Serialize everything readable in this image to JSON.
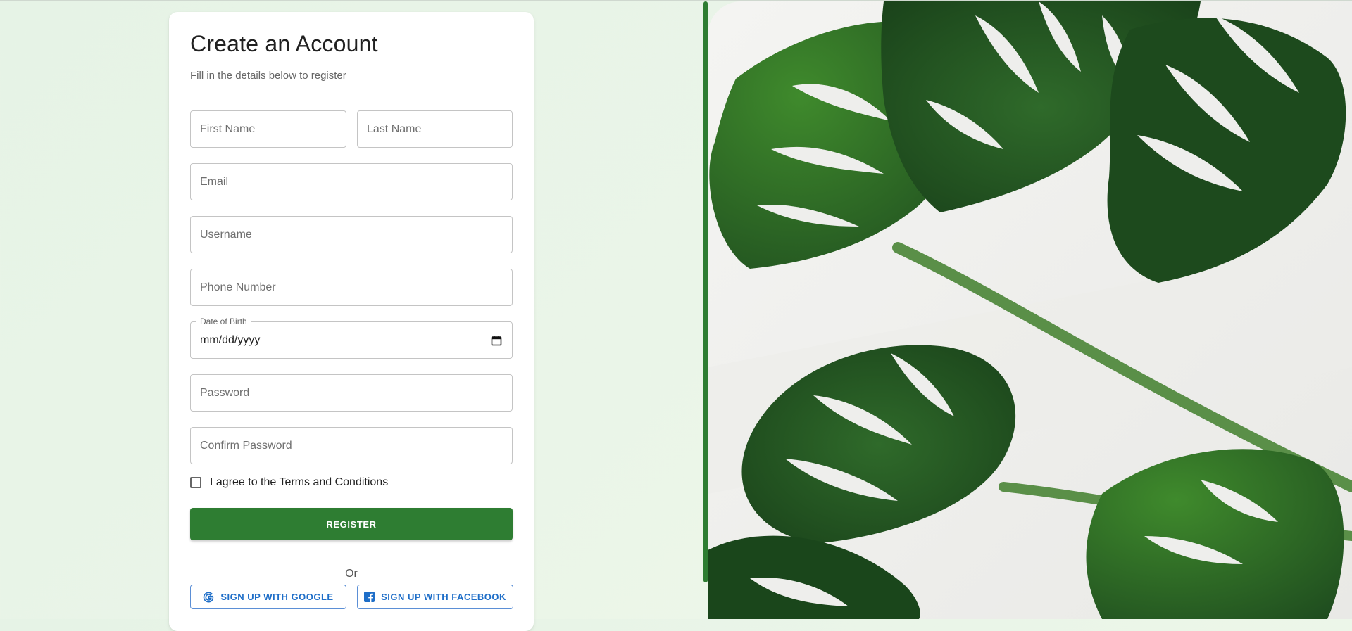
{
  "form": {
    "title": "Create an Account",
    "subtitle": "Fill in the details below to register",
    "first_name_placeholder": "First Name",
    "last_name_placeholder": "Last Name",
    "email_placeholder": "Email",
    "username_placeholder": "Username",
    "phone_placeholder": "Phone Number",
    "dob_label": "Date of Birth",
    "dob_value": "mm/dd/yyyy",
    "password_placeholder": "Password",
    "confirm_password_placeholder": "Confirm Password",
    "terms_label": "I agree to the Terms and Conditions",
    "terms_checked": false,
    "register_label": "REGISTER",
    "divider_text": "Or",
    "google_label": "SIGN UP WITH GOOGLE",
    "facebook_label": "SIGN UP WITH FACEBOOK"
  },
  "icons": {
    "google": "google-icon",
    "facebook": "facebook-icon",
    "calendar": "calendar-icon"
  },
  "colors": {
    "primary": "#2e7d32",
    "social_text": "#1e6ec8",
    "page_background": "#e8f4e7"
  }
}
